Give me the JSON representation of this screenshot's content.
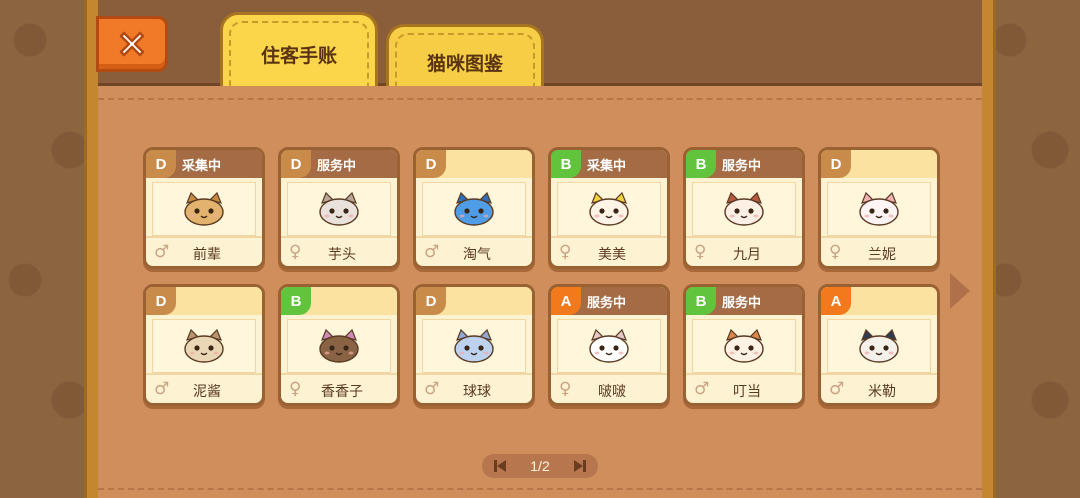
{
  "tabs": [
    {
      "label": "住客手账",
      "active": true
    },
    {
      "label": "猫咪图鉴",
      "active": false
    }
  ],
  "close_icon": "close-x-icon",
  "cards": [
    {
      "grade": "D",
      "status": "采集中",
      "name": "前辈",
      "gender": "male",
      "gender_symbol": "♂",
      "color": "#e2b36e",
      "ear": "#c78a45"
    },
    {
      "grade": "D",
      "status": "服务中",
      "name": "芋头",
      "gender": "female",
      "gender_symbol": "♀",
      "color": "#e9e2dc",
      "ear": "#b9a79a"
    },
    {
      "grade": "D",
      "status": "",
      "name": "淘气",
      "gender": "male",
      "gender_symbol": "♂",
      "color": "#4f9de6",
      "ear": "#2f6fb8"
    },
    {
      "grade": "B",
      "status": "采集中",
      "name": "美美",
      "gender": "female",
      "gender_symbol": "♀",
      "color": "#fff4e6",
      "ear": "#f6d23c"
    },
    {
      "grade": "B",
      "status": "服务中",
      "name": "九月",
      "gender": "female",
      "gender_symbol": "♀",
      "color": "#fff0e6",
      "ear": "#b65a3c"
    },
    {
      "grade": "D",
      "status": "",
      "name": "兰妮",
      "gender": "female",
      "gender_symbol": "♀",
      "color": "#fff5f5",
      "ear": "#f0b2b2"
    },
    {
      "grade": "D",
      "status": "",
      "name": "泥酱",
      "gender": "male",
      "gender_symbol": "♂",
      "color": "#ead7b6",
      "ear": "#b99570"
    },
    {
      "grade": "B",
      "status": "",
      "name": "香香子",
      "gender": "female",
      "gender_symbol": "♀",
      "color": "#8a6244",
      "ear": "#d08ab8"
    },
    {
      "grade": "D",
      "status": "",
      "name": "球球",
      "gender": "male",
      "gender_symbol": "♂",
      "color": "#bcd2ef",
      "ear": "#8fa8d4"
    },
    {
      "grade": "A",
      "status": "服务中",
      "name": "啵啵",
      "gender": "female",
      "gender_symbol": "♀",
      "color": "#ffffff",
      "ear": "#e6c9c9"
    },
    {
      "grade": "B",
      "status": "服务中",
      "name": "叮当",
      "gender": "male",
      "gender_symbol": "♂",
      "color": "#fff2e4",
      "ear": "#d9874a"
    },
    {
      "grade": "A",
      "status": "",
      "name": "米勒",
      "gender": "male",
      "gender_symbol": "♂",
      "color": "#f4f0ea",
      "ear": "#2e3a52"
    }
  ],
  "pagination": {
    "label": "1/2",
    "current": 1,
    "total": 2
  },
  "colors": {
    "grade_D": "#c98b4a",
    "grade_B": "#62c43c",
    "grade_A": "#f27a1c",
    "tab_yellow": "#fbd64a",
    "close_orange": "#f07a28"
  }
}
